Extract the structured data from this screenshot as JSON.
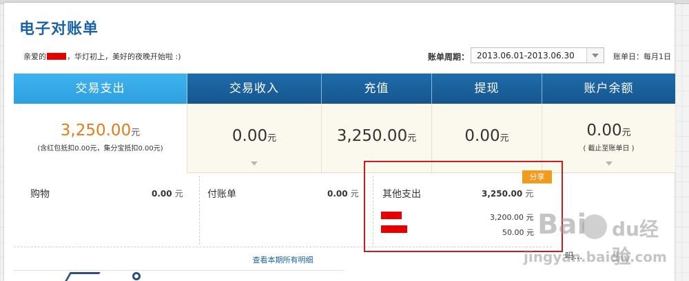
{
  "header": {
    "title": "电子对账单",
    "greeting_prefix": "亲爱的",
    "greeting_suffix": "，华灯初上，美好的夜晚开始啦 :)",
    "period_label": "账单周期：",
    "period_value": "2013.06.01-2013.06.30",
    "bill_day": "账单日：每月1日"
  },
  "summary": {
    "columns": [
      {
        "head": "交易支出",
        "amount": "3,250.00",
        "unit": "元",
        "note": "(含红包抵扣0.00元，集分宝抵扣0.00元)"
      },
      {
        "head": "交易收入",
        "amount": "0.00",
        "unit": "元"
      },
      {
        "head": "充值",
        "amount": "3,250.00",
        "unit": "元"
      },
      {
        "head": "提现",
        "amount": "0.00",
        "unit": "元"
      },
      {
        "head": "账户余额",
        "amount": "0.00",
        "unit": "元",
        "note": "( 截止至账单日 )"
      }
    ]
  },
  "detail": {
    "shopping": {
      "name": "购物",
      "value": "0.00",
      "unit": "元"
    },
    "pay_bill": {
      "name": "付账单",
      "value": "0.00",
      "unit": "元"
    },
    "other": {
      "name": "其他支出",
      "value": "3,250.00",
      "unit": "元",
      "items": [
        {
          "value": "3,200.00",
          "unit": "元"
        },
        {
          "value": "50.00",
          "unit": "元"
        }
      ]
    },
    "share_label": "分享",
    "view_all": "查看本期所有明细"
  },
  "watermark": {
    "logo": "Bai",
    "logo_tail": "du",
    "sub": "经验",
    "url": "jingyan.baidu.com",
    "partial_text": "吗..."
  },
  "colors": {
    "title": "#1a63a8",
    "header_blue": "#1e6bab",
    "header_active": "#3fb2ef",
    "amount_orange": "#e07d1a",
    "share_orange": "#f29a1c",
    "highlight_red": "#cc1a1a"
  }
}
